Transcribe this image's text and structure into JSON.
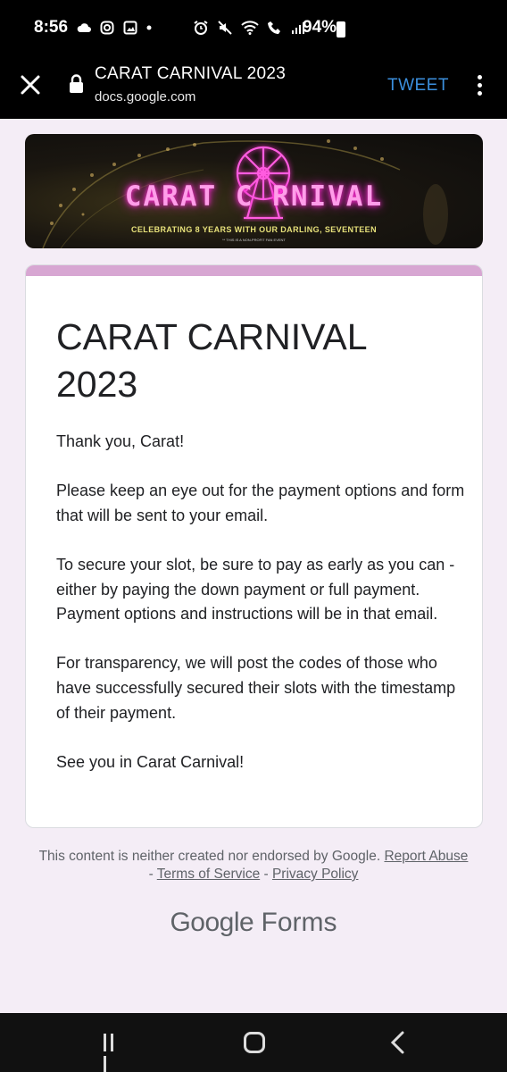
{
  "status_bar": {
    "time": "8:56",
    "battery": "94%",
    "icons": [
      "cloud-icon",
      "instagram-icon",
      "gallery-icon",
      "dot-icon",
      "alarm-icon",
      "mute-icon",
      "wifi-icon",
      "wifi-call-icon",
      "signal-icon",
      "battery-icon"
    ]
  },
  "browser": {
    "title": "CARAT CARNIVAL 2023",
    "url": "docs.google.com",
    "action_label": "TWEET",
    "accent_color": "#3b8fdd"
  },
  "banner": {
    "title": "CARAT C   RNIVAL",
    "subtitle": "CELEBRATING 8 YEARS WITH OUR DARLING, SEVENTEEN",
    "note": "** THIS IS A NON-PROFIT FAN EVENT"
  },
  "form": {
    "title": "CARAT CARNIVAL 2023",
    "accent_color": "#d7a6d2",
    "paragraphs": [
      "Thank you, Carat!",
      "Please keep an eye out for the payment options and form that will be sent to your email.",
      "To secure your slot, be sure to pay as early as you can - either by paying the down payment or full payment. Payment options and instructions will be in that email.",
      "For transparency, we will post the codes of those who have successfully secured their slots with the timestamp of their payment.",
      "See you in Carat Carnival!"
    ]
  },
  "footer": {
    "disclaimer": "This content is neither created nor endorsed by Google.",
    "report_abuse": "Report Abuse",
    "sep1": " - ",
    "terms": "Terms of Service",
    "sep2": " - ",
    "privacy": "Privacy Policy",
    "brand_google": "Google",
    "brand_forms": "Forms"
  }
}
